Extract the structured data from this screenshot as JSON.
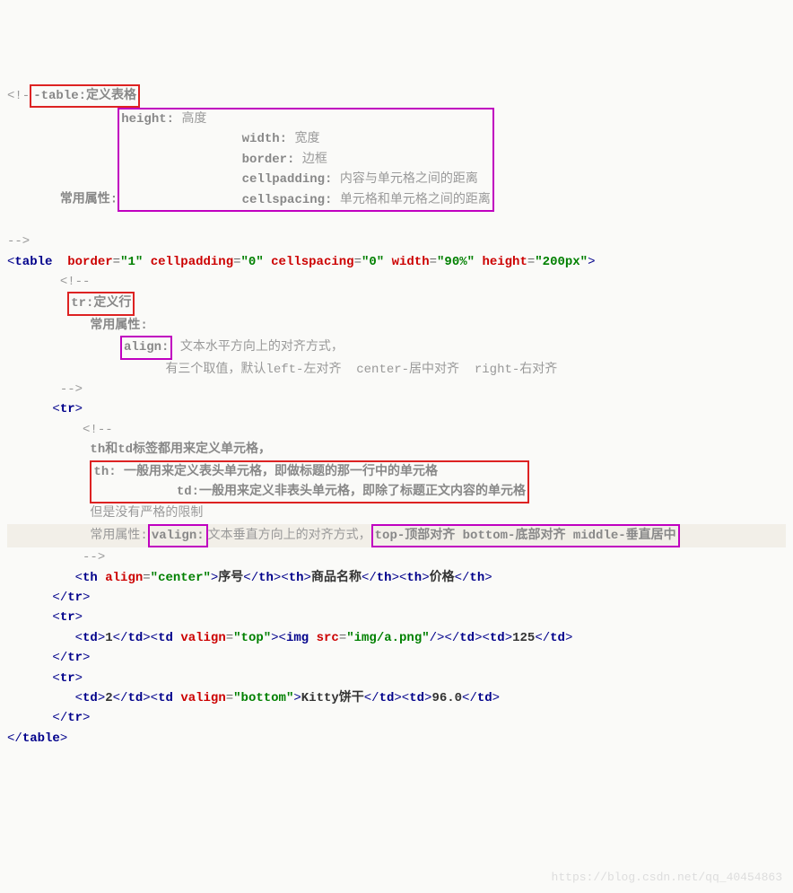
{
  "code": {
    "l1_prefix": "<!-",
    "l1_box": "-table:定义表格",
    "l2_label": "常用属性:",
    "l2_attrs": {
      "height": "height:",
      "height_desc": "高度",
      "width": "width:",
      "width_desc": "宽度",
      "border": "border:",
      "border_desc": "边框",
      "cellpadding": "cellpadding:",
      "cellpadding_desc": "内容与单元格之间的距离",
      "cellspacing": "cellspacing:",
      "cellspacing_desc": "单元格和单元格之间的距离"
    },
    "close_comment": "-->",
    "table_open": {
      "tag": "table",
      "border": "border",
      "border_v": "\"1\"",
      "cellpadding": "cellpadding",
      "cellpadding_v": "\"0\"",
      "cellspacing": "cellspacing",
      "cellspacing_v": "\"0\"",
      "width": "width",
      "width_v": "\"90%\"",
      "height": "height",
      "height_v": "\"200px\""
    },
    "sub_comment_open": "<!--",
    "tr_box": "tr:定义行",
    "tr_attr_label": "常用属性:",
    "align_box": "align:",
    "align_desc": "文本水平方向上的对齐方式，",
    "align_values": "有三个取值，默认left-左对齐  center-居中对齐  right-右对齐",
    "tr_tag": "tr",
    "th_td_line": "th和td标签都用来定义单元格，",
    "th_desc": "th: 一般用来定义表头单元格，即做标题的那一行中的单元格",
    "td_desc": "td:一般用来定义非表头单元格，即除了标题正文内容的单元格",
    "no_limit": "但是没有严格的限制",
    "valign_label": "常用属性:",
    "valign_box": "valign:",
    "valign_desc": "文本垂直方向上的对齐方式，",
    "valign_values": "top-顶部对齐 bottom-底部对齐 middle-垂直居中",
    "row1": {
      "th_open": "th",
      "align_attr": "align",
      "align_v": "\"center\"",
      "c1": "序号",
      "c2": "商品名称",
      "c3": "价格"
    },
    "row2": {
      "td": "td",
      "c1": "1",
      "valign_attr": "valign",
      "valign_v": "\"top\"",
      "img_tag": "img",
      "src_attr": "src",
      "src_v": "\"img/a.png\"",
      "c3": "125"
    },
    "row3": {
      "c1": "2",
      "valign_v": "\"bottom\"",
      "c2": "Kitty饼干",
      "c3": "96.0"
    },
    "table_close": "table"
  },
  "watermark": "https://blog.csdn.net/qq_40454863"
}
